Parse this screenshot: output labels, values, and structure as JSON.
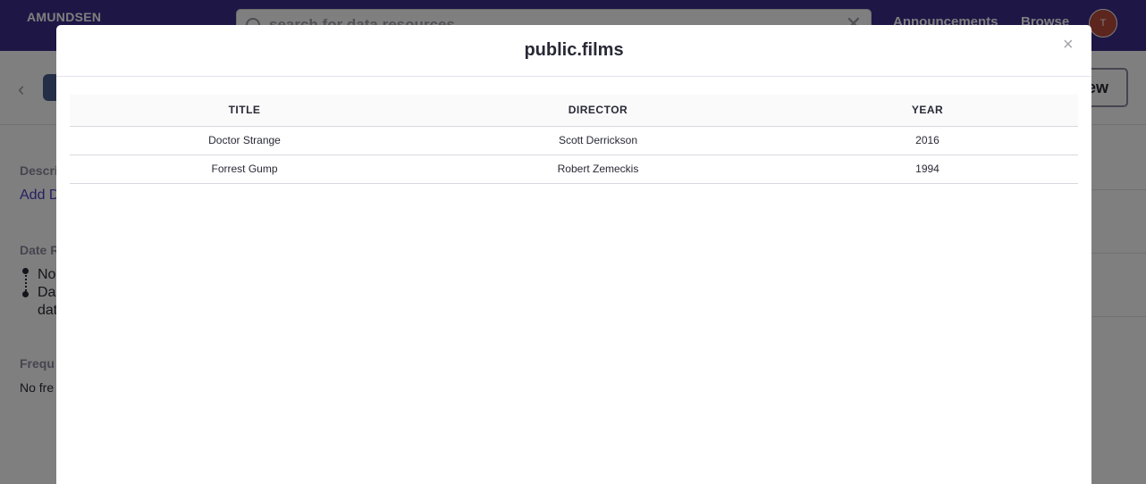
{
  "app": {
    "brand": "AMUNDSEN"
  },
  "search": {
    "placeholder": "search for data resources"
  },
  "nav": {
    "announcements": "Announcements",
    "browse": "Browse",
    "avatar_initial": "T"
  },
  "header": {
    "view_button_partial": "ew"
  },
  "background_details": {
    "description_label": "Descri",
    "add_description_link": "Add D",
    "date_range_label": "Date R",
    "date_range_lines": [
      "No",
      "Da",
      "dat"
    ],
    "frequency_label": "Frequ",
    "frequency_value": "No fre"
  },
  "modal": {
    "title": "public.films",
    "close_symbol": "×",
    "table": {
      "columns": [
        "TITLE",
        "DIRECTOR",
        "YEAR"
      ],
      "rows": [
        [
          "Doctor Strange",
          "Scott Derrickson",
          "2016"
        ],
        [
          "Forrest Gump",
          "Robert Zemeckis",
          "1994"
        ]
      ]
    }
  },
  "colors": {
    "nav_background": "#3d2c8a",
    "avatar": "#b84a3a",
    "link": "#4b3fc1",
    "backdrop": "rgba(0,0,0,0.5)"
  },
  "icons": [
    "search-icon",
    "clear-icon",
    "chevron-left-icon",
    "database-icon",
    "close-icon"
  ]
}
